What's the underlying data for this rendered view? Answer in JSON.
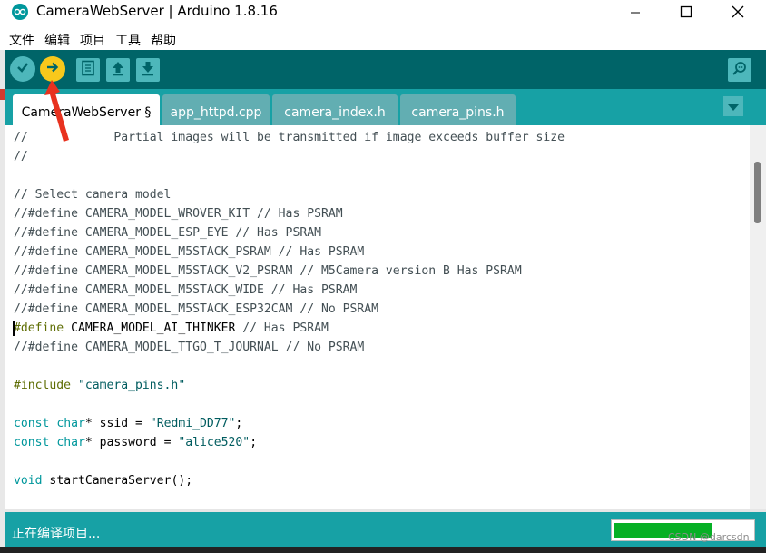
{
  "window": {
    "title": "CameraWebServer | Arduino 1.8.16",
    "controls": [
      "minimize-icon",
      "maximize-icon",
      "close-icon"
    ]
  },
  "menu": {
    "items": [
      {
        "label": "文件"
      },
      {
        "label": "编辑"
      },
      {
        "label": "项目"
      },
      {
        "label": "工具"
      },
      {
        "label": "帮助"
      }
    ]
  },
  "toolbar": {
    "buttons": [
      "verify-icon",
      "upload-icon",
      "new-icon",
      "open-icon",
      "save-icon",
      "serial-monitor-icon"
    ]
  },
  "tabs": [
    {
      "label": "CameraWebServer §",
      "active": true
    },
    {
      "label": "app_httpd.cpp",
      "active": false
    },
    {
      "label": "camera_index.h",
      "active": false
    },
    {
      "label": "camera_pins.h",
      "active": false
    }
  ],
  "editor": {
    "lines": [
      "//            Partial images will be transmitted if image exceeds buffer size",
      "//",
      "",
      "// Select camera model",
      "//#define CAMERA_MODEL_WROVER_KIT // Has PSRAM",
      "//#define CAMERA_MODEL_ESP_EYE // Has PSRAM",
      "//#define CAMERA_MODEL_M5STACK_PSRAM // Has PSRAM",
      "//#define CAMERA_MODEL_M5STACK_V2_PSRAM // M5Camera version B Has PSRAM",
      "//#define CAMERA_MODEL_M5STACK_WIDE // Has PSRAM",
      "//#define CAMERA_MODEL_M5STACK_ESP32CAM // No PSRAM",
      "#define CAMERA_MODEL_AI_THINKER // Has PSRAM",
      "//#define CAMERA_MODEL_TTGO_T_JOURNAL // No PSRAM",
      "",
      "#include \"camera_pins.h\"",
      "",
      "const char* ssid = \"Redmi_DD77\";",
      "const char* password = \"alice520\";",
      "",
      "void startCameraServer();"
    ]
  },
  "status": {
    "text": "正在编译项目...",
    "progress_fraction": 0.71
  },
  "watermark": "CSDN @darcsdn",
  "colors": {
    "teal_dark": "#006468",
    "teal": "#17a1a5",
    "accent_yellow": "#f8c81c",
    "progress_green": "#06b025",
    "annotation_red": "#e8321f"
  }
}
